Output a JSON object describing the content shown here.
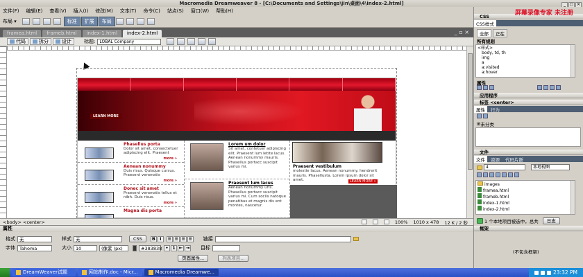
{
  "window": {
    "title": "Macromedia Dreamweaver 8 - [C:\\Documents and Settings\\jin\\桌面\\4\\index-2.html]",
    "watermark": "屏幕录像专家 未注册"
  },
  "menu": [
    "文件(F)",
    "编辑(E)",
    "查看(V)",
    "插入(I)",
    "修改(M)",
    "文本(T)",
    "命令(C)",
    "站点(S)",
    "窗口(W)",
    "帮助(H)"
  ],
  "insert_bar": {
    "category": "布局",
    "tabs": [
      "标准",
      "扩展",
      "布局"
    ]
  },
  "doc_tabs": [
    "frameа.html",
    "frameb.html",
    "index-1.html",
    "index-2.html"
  ],
  "doc_toolbar": {
    "views": [
      "代码",
      "拆分",
      "设计"
    ],
    "title_label": "标题:",
    "title_value": "LOBAL Company"
  },
  "page": {
    "learn_more": "LEARN MORE",
    "news": [
      {
        "title": "Phasellus porta",
        "text": "Dolor sit amet, consectetuer adipiscing elit. Praesent",
        "more": "more »"
      },
      {
        "title": "Aenean nonummy",
        "text": "Duis risus. Quisque cursus. Praesent venenatis",
        "more": "more »"
      },
      {
        "title": "Donec sit amet",
        "text": "Praesent venenatis tellus et nibh. Duis risus.",
        "more": "more »"
      },
      {
        "title": "Magna dis porta",
        "text": "",
        "more": ""
      }
    ],
    "features": [
      {
        "title": "Lorem um dolor",
        "text": "Sit amet, contetuer adipiscing elit. Praesent lum letite lacus. Aenean nonummy mauris. Phasellus portacc suscipit varius mi."
      },
      {
        "title": "Praesent lum lacus",
        "text": "Aenean nonummy urls. Phasellus portacc suscipit varius mi. Cum sociis natoque penatibus et magnis dis ent montes, nascetur."
      }
    ],
    "right": {
      "title": "Praesent vestibulum",
      "text": "molestie lacus. Aenean nonummy. hendrerit mauris. Phasellusta. Lorem ipsum dolor sit amet.",
      "more": "LEARN MORE »"
    }
  },
  "status": {
    "tag": "<body> <center>",
    "zoom": "100%",
    "size": "1010 x 478",
    "weight": "12 K / 2 秒"
  },
  "properties": {
    "header": "属性",
    "format_label": "格式",
    "format_value": "无",
    "style_label": "样式",
    "style_value": "无",
    "css_button": "CSS",
    "link_label": "链接",
    "font_label": "字体",
    "font_value": "Tahoma",
    "size_label": "大小",
    "size_value": "10",
    "unit_value": "(像素 (px)",
    "color_value": "#383838",
    "target_label": "目标",
    "page_props_button": "页面属性...",
    "list_button": "列表项目..."
  },
  "sidebar": {
    "css_header": "CSS",
    "css_tabs": [
      "CSS样式"
    ],
    "mode_tabs": [
      "全部",
      "正在"
    ],
    "rules_label": "所有规则",
    "rules": [
      "<样式>",
      "body, td, th",
      "img",
      "a",
      "a:visited",
      "a:hover"
    ],
    "props_label": "属性",
    "app_header": "应用程序",
    "tag_header": "标签 <center>",
    "tag_tabs": [
      "属性",
      "行为"
    ],
    "unclassified": "未分类",
    "files_header": "文件",
    "files_tabs": [
      "文件",
      "资源",
      "代码片断"
    ],
    "site_value": "4",
    "view_value": "本地视图",
    "file_tree": [
      "images",
      "frameа.html",
      "frameb.html",
      "index-1.html",
      "index-2.html"
    ],
    "file_status": "1 个本地项目被选中，总共",
    "log_button": "日志",
    "frames_header": "框架",
    "no_frames": "(不包含框架)"
  },
  "taskbar": {
    "items": [
      "DreamWeaver试题",
      "网站制作.doc - Micr...",
      "Macromedia Dreamwe..."
    ],
    "clock": "23:32 PM"
  }
}
